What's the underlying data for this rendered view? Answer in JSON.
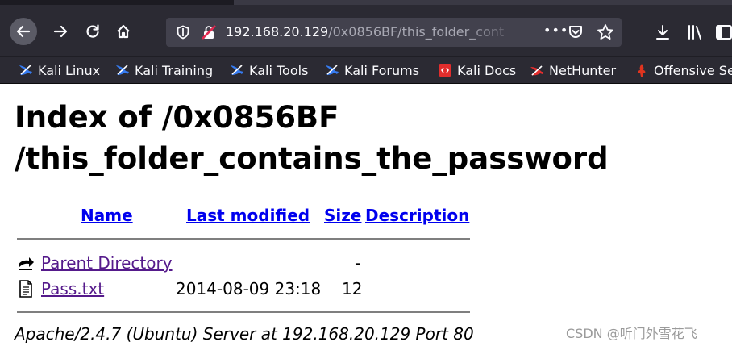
{
  "browser": {
    "url_host": "192.168.20.129",
    "url_path": "/0x0856BF/this_folder_cont",
    "url_more": "•••",
    "bookmarks": [
      {
        "label": "Kali Linux",
        "icon": "kali-dragon-icon"
      },
      {
        "label": "Kali Training",
        "icon": "kali-dragon-icon"
      },
      {
        "label": "Kali Tools",
        "icon": "kali-dragon-icon"
      },
      {
        "label": "Kali Forums",
        "icon": "kali-dragon-icon"
      },
      {
        "label": "Kali Docs",
        "icon": "kali-docs-icon"
      },
      {
        "label": "NetHunter",
        "icon": "nethunter-icon"
      },
      {
        "label": "Offensive Se",
        "icon": "offensive-security-icon"
      }
    ],
    "colors": {
      "chrome": "#2b2a33",
      "urlbar": "#42414d",
      "text": "#fbfbfe"
    }
  },
  "page": {
    "title_line1": "Index of /0x0856BF",
    "title_line2": "/this_folder_contains_the_password",
    "columns": {
      "name": "Name",
      "last_modified": "Last modified",
      "size": "Size",
      "description": "Description"
    },
    "rows": [
      {
        "name": "Parent Directory",
        "modified": "",
        "size": "-",
        "icon": "back-folder-icon"
      },
      {
        "name": "Pass.txt",
        "modified": "2014-08-09 23:18",
        "size": "12",
        "icon": "text-file-icon"
      }
    ],
    "address": "Apache/2.4.7 (Ubuntu) Server at 192.168.20.129 Port 80"
  },
  "watermark": "CSDN @听门外雪花飞",
  "colors": {
    "link_visited": "#551a8b",
    "link_header": "#0000ee"
  }
}
